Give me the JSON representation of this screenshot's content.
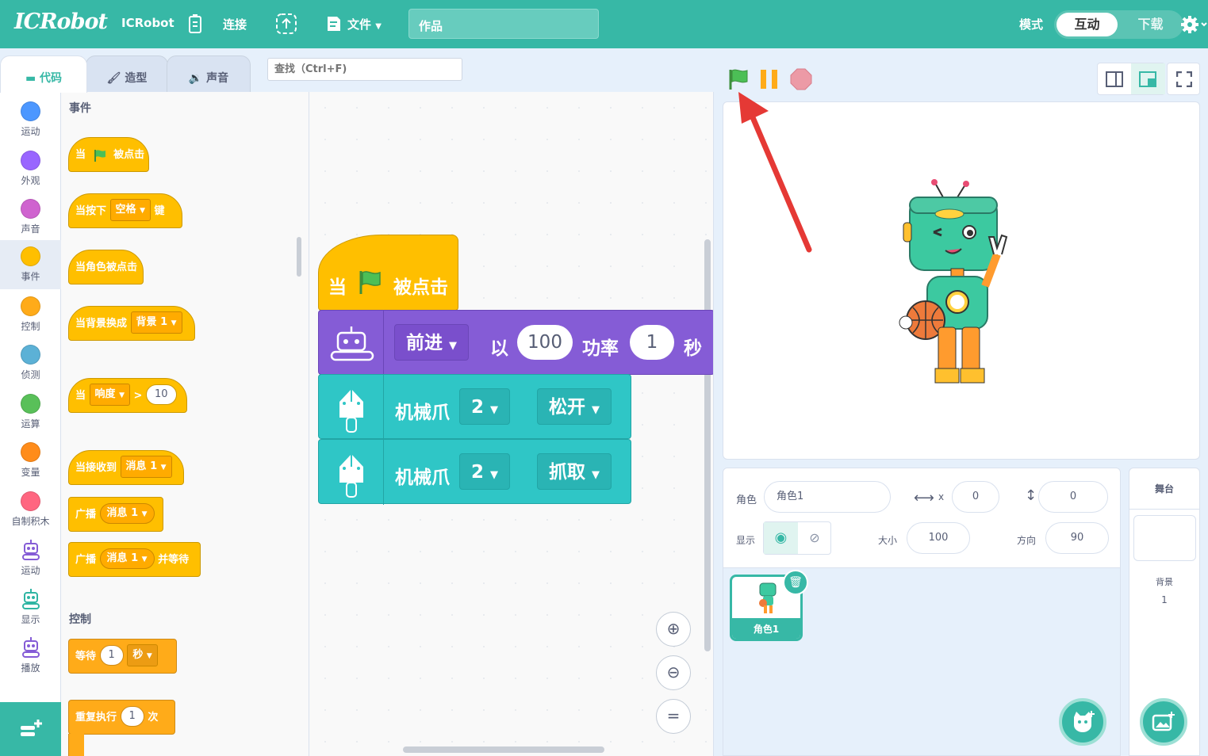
{
  "app": {
    "logo": "ICRobot",
    "name": "ICRobot",
    "connect_label": "连接",
    "file_label": "文件",
    "project_title": "作品",
    "mode_label": "模式",
    "mode_interactive": "互动",
    "mode_download": "下载"
  },
  "tabs": {
    "code": "代码",
    "costume": "造型",
    "sound": "声音"
  },
  "search": {
    "placeholder": "查找（Ctrl+F)"
  },
  "categories": [
    "运动",
    "外观",
    "声音",
    "事件",
    "控制",
    "侦测",
    "运算",
    "变量",
    "自制积木",
    "运动",
    "显示",
    "播放"
  ],
  "category_colors": [
    "#4c97ff",
    "#9966ff",
    "#cf63cf",
    "#ffbf00",
    "#ffab19",
    "#5cb1d6",
    "#59c059",
    "#ff8c1a",
    "#ff6680"
  ],
  "palette": {
    "events_title": "事件",
    "when_flag_pre": "当",
    "when_flag_post": "被点击",
    "when_key": "当按下",
    "key_value": "空格",
    "key_suffix": "键",
    "when_sprite_clicked": "当角色被点击",
    "when_backdrop": "当背景换成",
    "backdrop_value": "背景 1",
    "when_pre": "当",
    "loudness": "响度",
    "gt": ">",
    "loud_value": "10",
    "when_receive": "当接收到",
    "message": "消息 1",
    "broadcast": "广播",
    "broadcast_wait_suffix": "并等待",
    "control_title": "控制",
    "wait": "等待",
    "wait_value": "1",
    "seconds": "秒",
    "repeat": "重复执行",
    "repeat_value": "1",
    "times": "次"
  },
  "script": {
    "hat_pre": "当",
    "hat_post": "被点击",
    "move_dir": "前进",
    "move_with": "以",
    "move_power_value": "100",
    "move_power_label": "功率",
    "move_time_value": "1",
    "move_sec": "秒",
    "claw1_label": "机械爪",
    "claw1_num": "2",
    "claw1_action": "松开",
    "claw2_label": "机械爪",
    "claw2_num": "2",
    "claw2_action": "抓取"
  },
  "sprite_info": {
    "sprite_label": "角色",
    "sprite_name": "角色1",
    "x_label": "x",
    "x_value": "0",
    "y_label": "y",
    "y_value": "0",
    "show_label": "显示",
    "size_label": "大小",
    "size_value": "100",
    "direction_label": "方向",
    "direction_value": "90"
  },
  "sprite_list": [
    {
      "name": "角色1"
    }
  ],
  "stage_panel": {
    "title": "舞台",
    "backdrops_label": "背景",
    "backdrops_count": "1"
  },
  "colors": {
    "teal": "#37b8a6",
    "events": "#ffbf00",
    "motion_robot": "#855cd6",
    "claw": "#2fc6c6",
    "arrow": "#e53935"
  }
}
